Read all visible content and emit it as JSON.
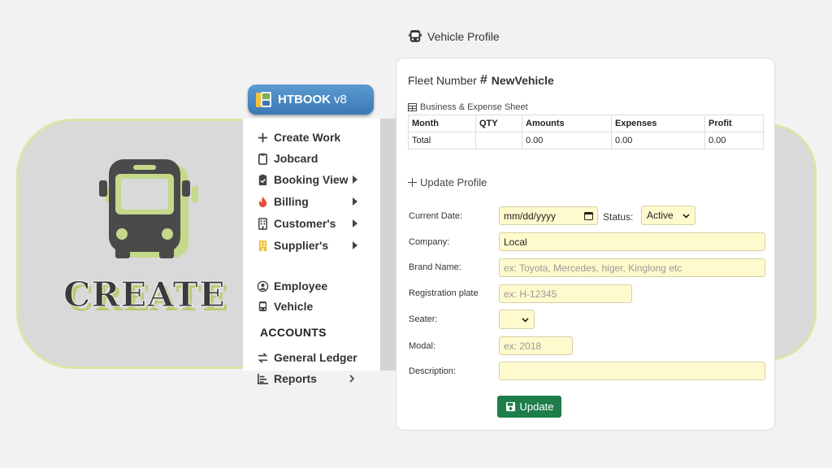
{
  "hero": {
    "word": "CREATE",
    "icon": "bus-icon"
  },
  "brand": {
    "name": "HTBOOK",
    "version": "v8",
    "icon": "book-logo-icon"
  },
  "sidebar": {
    "items": [
      {
        "label": "Create Work",
        "icon": "plus-icon"
      },
      {
        "label": "Jobcard",
        "icon": "clipboard-icon"
      },
      {
        "label": "Booking View",
        "icon": "clipboard-check-icon",
        "submenu": true
      },
      {
        "label": "Billing",
        "icon": "fire-icon",
        "submenu": true
      },
      {
        "label": "Customer's",
        "icon": "building-icon",
        "submenu": true
      },
      {
        "label": "Supplier's",
        "icon": "building-icon",
        "submenu": true
      },
      {
        "label": "Employee",
        "icon": "user-circle-icon"
      },
      {
        "label": "Vehicle",
        "icon": "bus-icon"
      },
      {
        "label": "General Ledger",
        "icon": "exchange-icon"
      },
      {
        "label": "Reports",
        "icon": "chart-icon",
        "submenu": true
      }
    ],
    "accounts_heading": "ACCOUNTS"
  },
  "header": {
    "title": "Vehicle Profile"
  },
  "fleet": {
    "label": "Fleet Number",
    "number": "NewVehicle"
  },
  "sheet": {
    "caption": "Business & Expense Sheet",
    "columns": [
      "Month",
      "QTY",
      "Amounts",
      "Expenses",
      "Profit"
    ],
    "rows": [
      [
        "Total",
        "",
        "0.00",
        "0.00",
        "0.00"
      ]
    ]
  },
  "form": {
    "section_title": "Update Profile",
    "current_date_label": "Current Date:",
    "current_date_placeholder": "mm/dd/yyyy",
    "status_label": "Status:",
    "status_value": "Active",
    "company_label": "Company:",
    "company_value": "Local",
    "brand_label": "Brand Name:",
    "brand_placeholder": "ex: Toyota, Mercedes, higer, Kinglong etc",
    "registration_label": "Registration plate",
    "registration_placeholder": "ex: H-12345",
    "seater_label": "Seater:",
    "seater_value": "",
    "modal_label": "Modal:",
    "modal_placeholder": "ex: 2018",
    "description_label": "Description:",
    "description_value": "",
    "update_button": "Update"
  },
  "colors": {
    "accent_green": "#1e7e4a",
    "brand_blue": "#4a8ac4",
    "field_yellow": "#fffacd",
    "lime_outline": "#d6e7a8"
  }
}
